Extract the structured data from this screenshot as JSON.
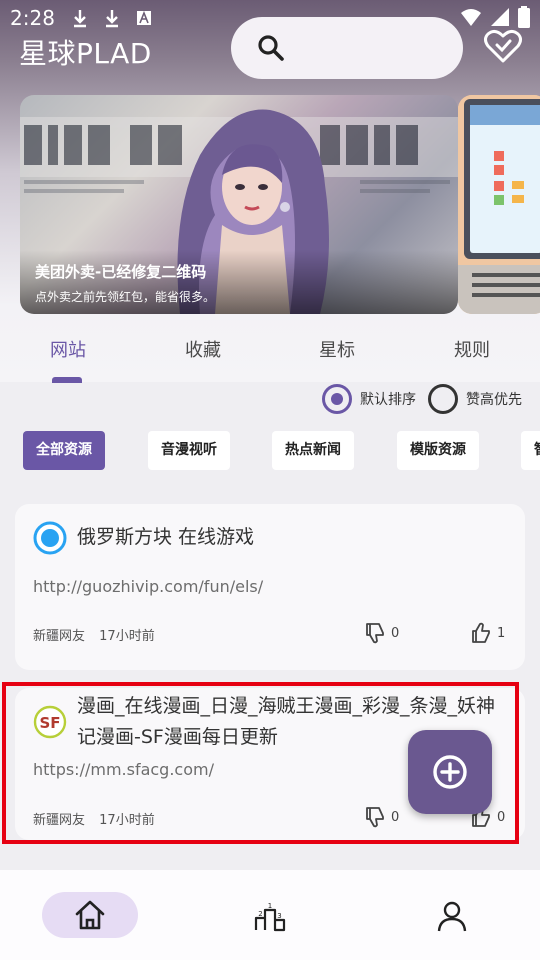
{
  "status_bar": {
    "time": "2:28"
  },
  "header": {
    "app_title": "星球PLAD",
    "search_icon": "search-icon",
    "favorite_icon": "heart-icon"
  },
  "banner": {
    "title": "美团外卖-已经修复二维码",
    "subtitle": "点外卖之前先领红包，能省很多。"
  },
  "tabs": [
    {
      "label": "网站",
      "active": true
    },
    {
      "label": "收藏"
    },
    {
      "label": "星标"
    },
    {
      "label": "规则"
    }
  ],
  "sort": {
    "default_label": "默认排序",
    "likes_label": "赞高优先",
    "selected": "默认排序"
  },
  "chips": [
    {
      "label": "全部资源",
      "active": true
    },
    {
      "label": "音漫视听"
    },
    {
      "label": "热点新闻"
    },
    {
      "label": "模版资源"
    },
    {
      "label": "智"
    }
  ],
  "cards": [
    {
      "title": "俄罗斯方块 在线游戏",
      "url": "http://guozhivip.com/fun/els/",
      "author": "新疆网友",
      "time": "17小时前",
      "dislikes": "0",
      "likes": "1"
    },
    {
      "title": "漫画_在线漫画_日漫_海贼王漫画_彩漫_条漫_妖神记漫画-SF漫画每日更新",
      "url": "https://mm.sfacg.com/",
      "author": "新疆网友",
      "time": "17小时前",
      "dislikes": "0",
      "likes": "0"
    }
  ],
  "colors": {
    "accent": "#6a57a6",
    "fab": "#6a5890",
    "highlight": "#e60012"
  }
}
